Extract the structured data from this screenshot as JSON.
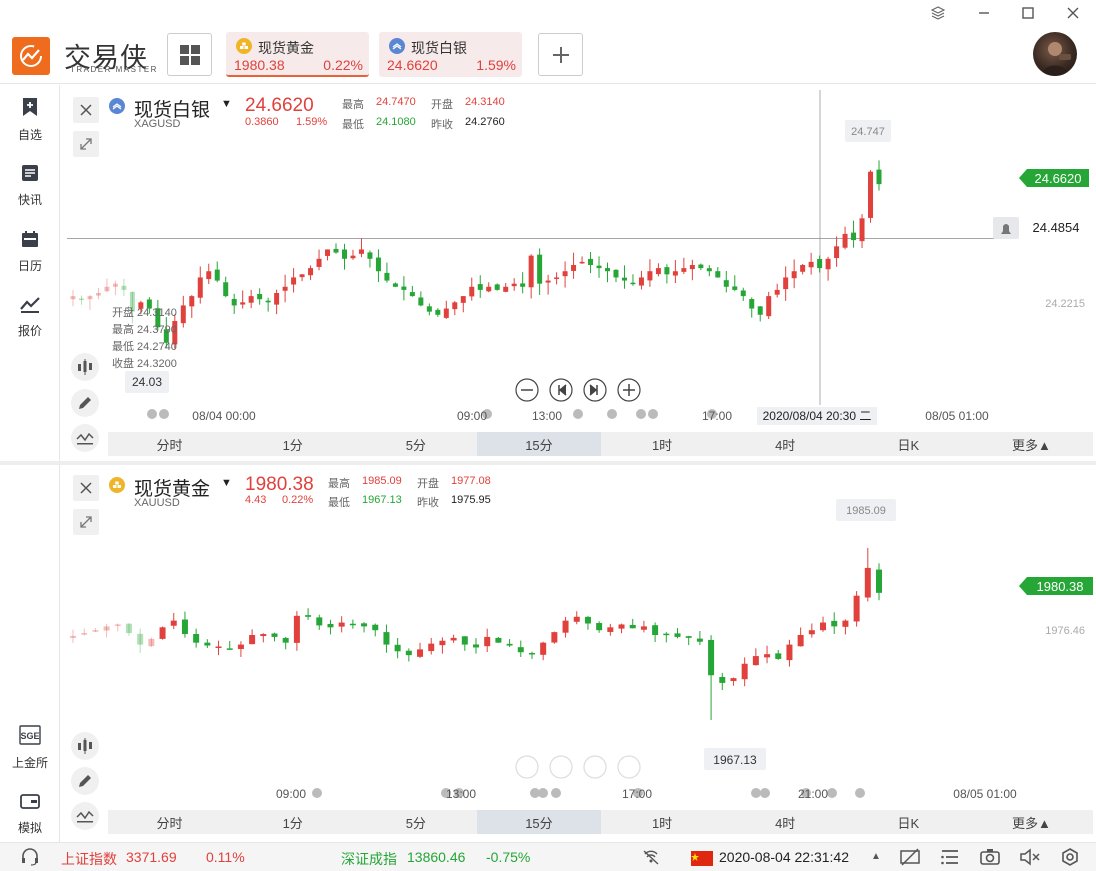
{
  "app": {
    "name": "交易侠",
    "subtitle": "TRADER MASTER"
  },
  "tabs": [
    {
      "name": "现货黄金",
      "price": "1980.38",
      "change": "0.22%",
      "icon": "gold-icon",
      "active": true
    },
    {
      "name": "现货白银",
      "price": "24.6620",
      "change": "1.59%",
      "icon": "silver-icon",
      "active": false
    }
  ],
  "sidebar": [
    {
      "label": "自选",
      "icon": "bookmark-add-icon"
    },
    {
      "label": "快讯",
      "icon": "news-icon"
    },
    {
      "label": "日历",
      "icon": "calendar-icon"
    },
    {
      "label": "报价",
      "icon": "quote-chart-icon"
    },
    {
      "label": "上金所",
      "icon": "sge-icon"
    },
    {
      "label": "模拟",
      "icon": "wallet-icon"
    }
  ],
  "silver": {
    "name": "现货白银",
    "symbol": "XAGUSD",
    "price": "24.6620",
    "change": "0.3860",
    "pct": "1.59%",
    "high_label": "最高",
    "high": "24.7470",
    "open_label": "开盘",
    "open": "24.3140",
    "low_label": "最低",
    "low": "24.1080",
    "prev_label": "昨收",
    "prev": "24.2760",
    "peak": "24.747",
    "current_tag": "24.6620",
    "cross_price": "24.4854",
    "ref_price": "24.2215",
    "low_tag": "24.03",
    "ohlc": {
      "open": "开盘 24.3140",
      "high": "最高 24.3790",
      "low": "最低 24.2740",
      "close": "收盘 24.3200"
    },
    "x_labels": [
      "08/04 00:00",
      "09:00",
      "13:00",
      "17:00",
      "08/05 01:00"
    ],
    "cross_time": "2020/08/04 20:30 二"
  },
  "gold": {
    "name": "现货黄金",
    "symbol": "XAUUSD",
    "price": "1980.38",
    "change": "4.43",
    "pct": "0.22%",
    "high_label": "最高",
    "high": "1985.09",
    "open_label": "开盘",
    "open": "1977.08",
    "low_label": "最低",
    "low": "1967.13",
    "prev_label": "昨收",
    "prev": "1975.95",
    "peak": "1985.09",
    "current_tag": "1980.38",
    "ref_price": "1976.46",
    "low_tag": "1967.13",
    "x_labels": [
      "09:00",
      "13:00",
      "17:00",
      "21:00",
      "08/05 01:00"
    ]
  },
  "timeframes": [
    "分时",
    "1分",
    "5分",
    "15分",
    "1时",
    "4时",
    "日K",
    "更多▲"
  ],
  "selected_timeframe": "15分",
  "status": {
    "idx1_name": "上证指数",
    "idx1_val": "3371.69",
    "idx1_pct": "0.11%",
    "idx2_name": "深证成指",
    "idx2_val": "13860.46",
    "idx2_pct": "-0.75%",
    "datetime": "2020-08-04 22:31:42"
  },
  "colors": {
    "up": "#e0413c",
    "down": "#25a636",
    "accent": "#ef6b1e"
  },
  "chart_data": [
    {
      "type": "candlestick",
      "title": "现货白银",
      "symbol": "XAGUSD",
      "current": 24.662,
      "high": 24.747,
      "low": 24.03,
      "ylim": [
        23.95,
        24.85
      ],
      "closes": [
        24.3,
        24.29,
        24.3,
        24.31,
        24.33,
        24.34,
        24.32,
        24.25,
        24.28,
        24.26,
        24.2,
        24.15,
        24.22,
        24.27,
        24.3,
        24.36,
        24.38,
        24.35,
        24.3,
        24.27,
        24.28,
        24.3,
        24.29,
        24.28,
        24.31,
        24.33,
        24.36,
        24.37,
        24.39,
        24.42,
        24.45,
        24.44,
        24.42,
        24.43,
        24.45,
        24.42,
        24.38,
        24.35,
        24.33,
        24.32,
        24.3,
        24.27,
        24.25,
        24.24,
        24.26,
        24.28,
        24.3,
        24.33,
        24.32,
        24.33,
        24.32,
        24.33,
        24.34,
        24.33,
        24.43,
        24.34,
        24.35,
        24.36,
        24.38,
        24.4,
        24.41,
        24.4,
        24.39,
        24.38,
        24.36,
        24.35,
        24.34,
        24.36,
        24.38,
        24.39,
        24.37,
        24.38,
        24.39,
        24.4,
        24.39,
        24.38,
        24.36,
        24.33,
        24.32,
        24.3,
        24.26,
        24.24,
        24.3,
        24.32,
        24.36,
        24.38,
        24.4,
        24.41,
        24.39,
        24.42,
        24.46,
        24.5,
        24.48,
        24.55,
        24.7,
        24.66
      ]
    }
  ]
}
